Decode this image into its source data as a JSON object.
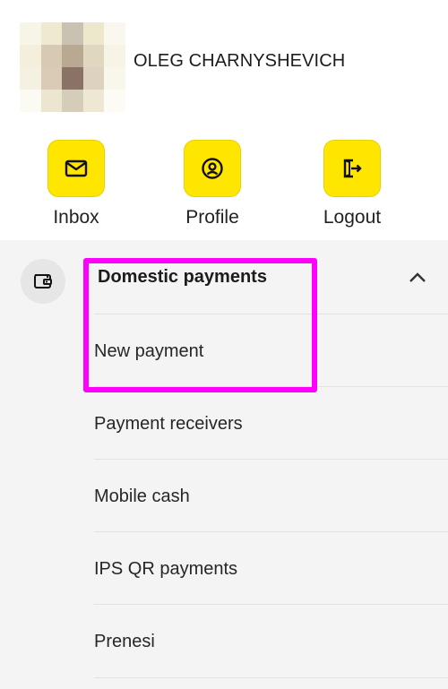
{
  "user": {
    "name": "OLEG CHARNYSHEVICH"
  },
  "actions": [
    {
      "label": "Inbox",
      "icon": "mail-icon"
    },
    {
      "label": "Profile",
      "icon": "user-icon"
    },
    {
      "label": "Logout",
      "icon": "logout-icon"
    }
  ],
  "menu": {
    "section_title": "Domestic payments",
    "section_icon": "wallet-icon",
    "items": [
      {
        "label": "New payment"
      },
      {
        "label": "Payment receivers"
      },
      {
        "label": "Mobile cash"
      },
      {
        "label": "IPS QR payments"
      },
      {
        "label": "Prenesi"
      }
    ]
  },
  "colors": {
    "accent": "#ffe600",
    "highlight": "#ff00ff",
    "menu_bg": "#f4f4f4"
  }
}
